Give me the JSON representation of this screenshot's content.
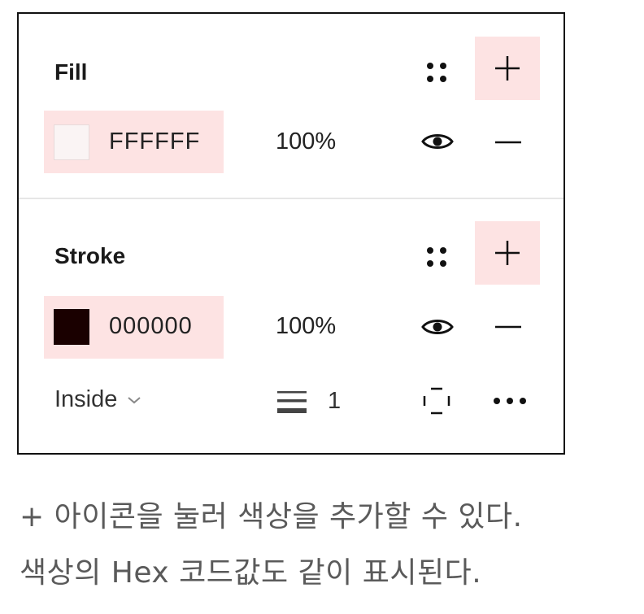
{
  "fill": {
    "title": "Fill",
    "hex": "FFFFFF",
    "opacity": "100%",
    "swatch_color": "#FAF4F4"
  },
  "stroke": {
    "title": "Stroke",
    "hex": "000000",
    "opacity": "100%",
    "swatch_color": "#1A0000",
    "position": "Inside",
    "weight": "1"
  },
  "icons": {
    "style": "grid-dots-icon",
    "add": "plus-icon",
    "visibility": "eye-icon",
    "remove": "minus-icon",
    "stroke_weight": "stroke-weight-icon",
    "individual_strokes": "dashed-square-icon",
    "more": "ellipsis-icon",
    "dropdown": "chevron-down-icon"
  },
  "colors": {
    "highlight": "#FDE3E3",
    "border": "#111111",
    "caption": "#5A5A5A"
  },
  "caption": {
    "line1": "+ 아이콘을 눌러 색상을 추가할 수 있다.",
    "line2": "색상의 Hex 코드값도 같이 표시된다."
  }
}
